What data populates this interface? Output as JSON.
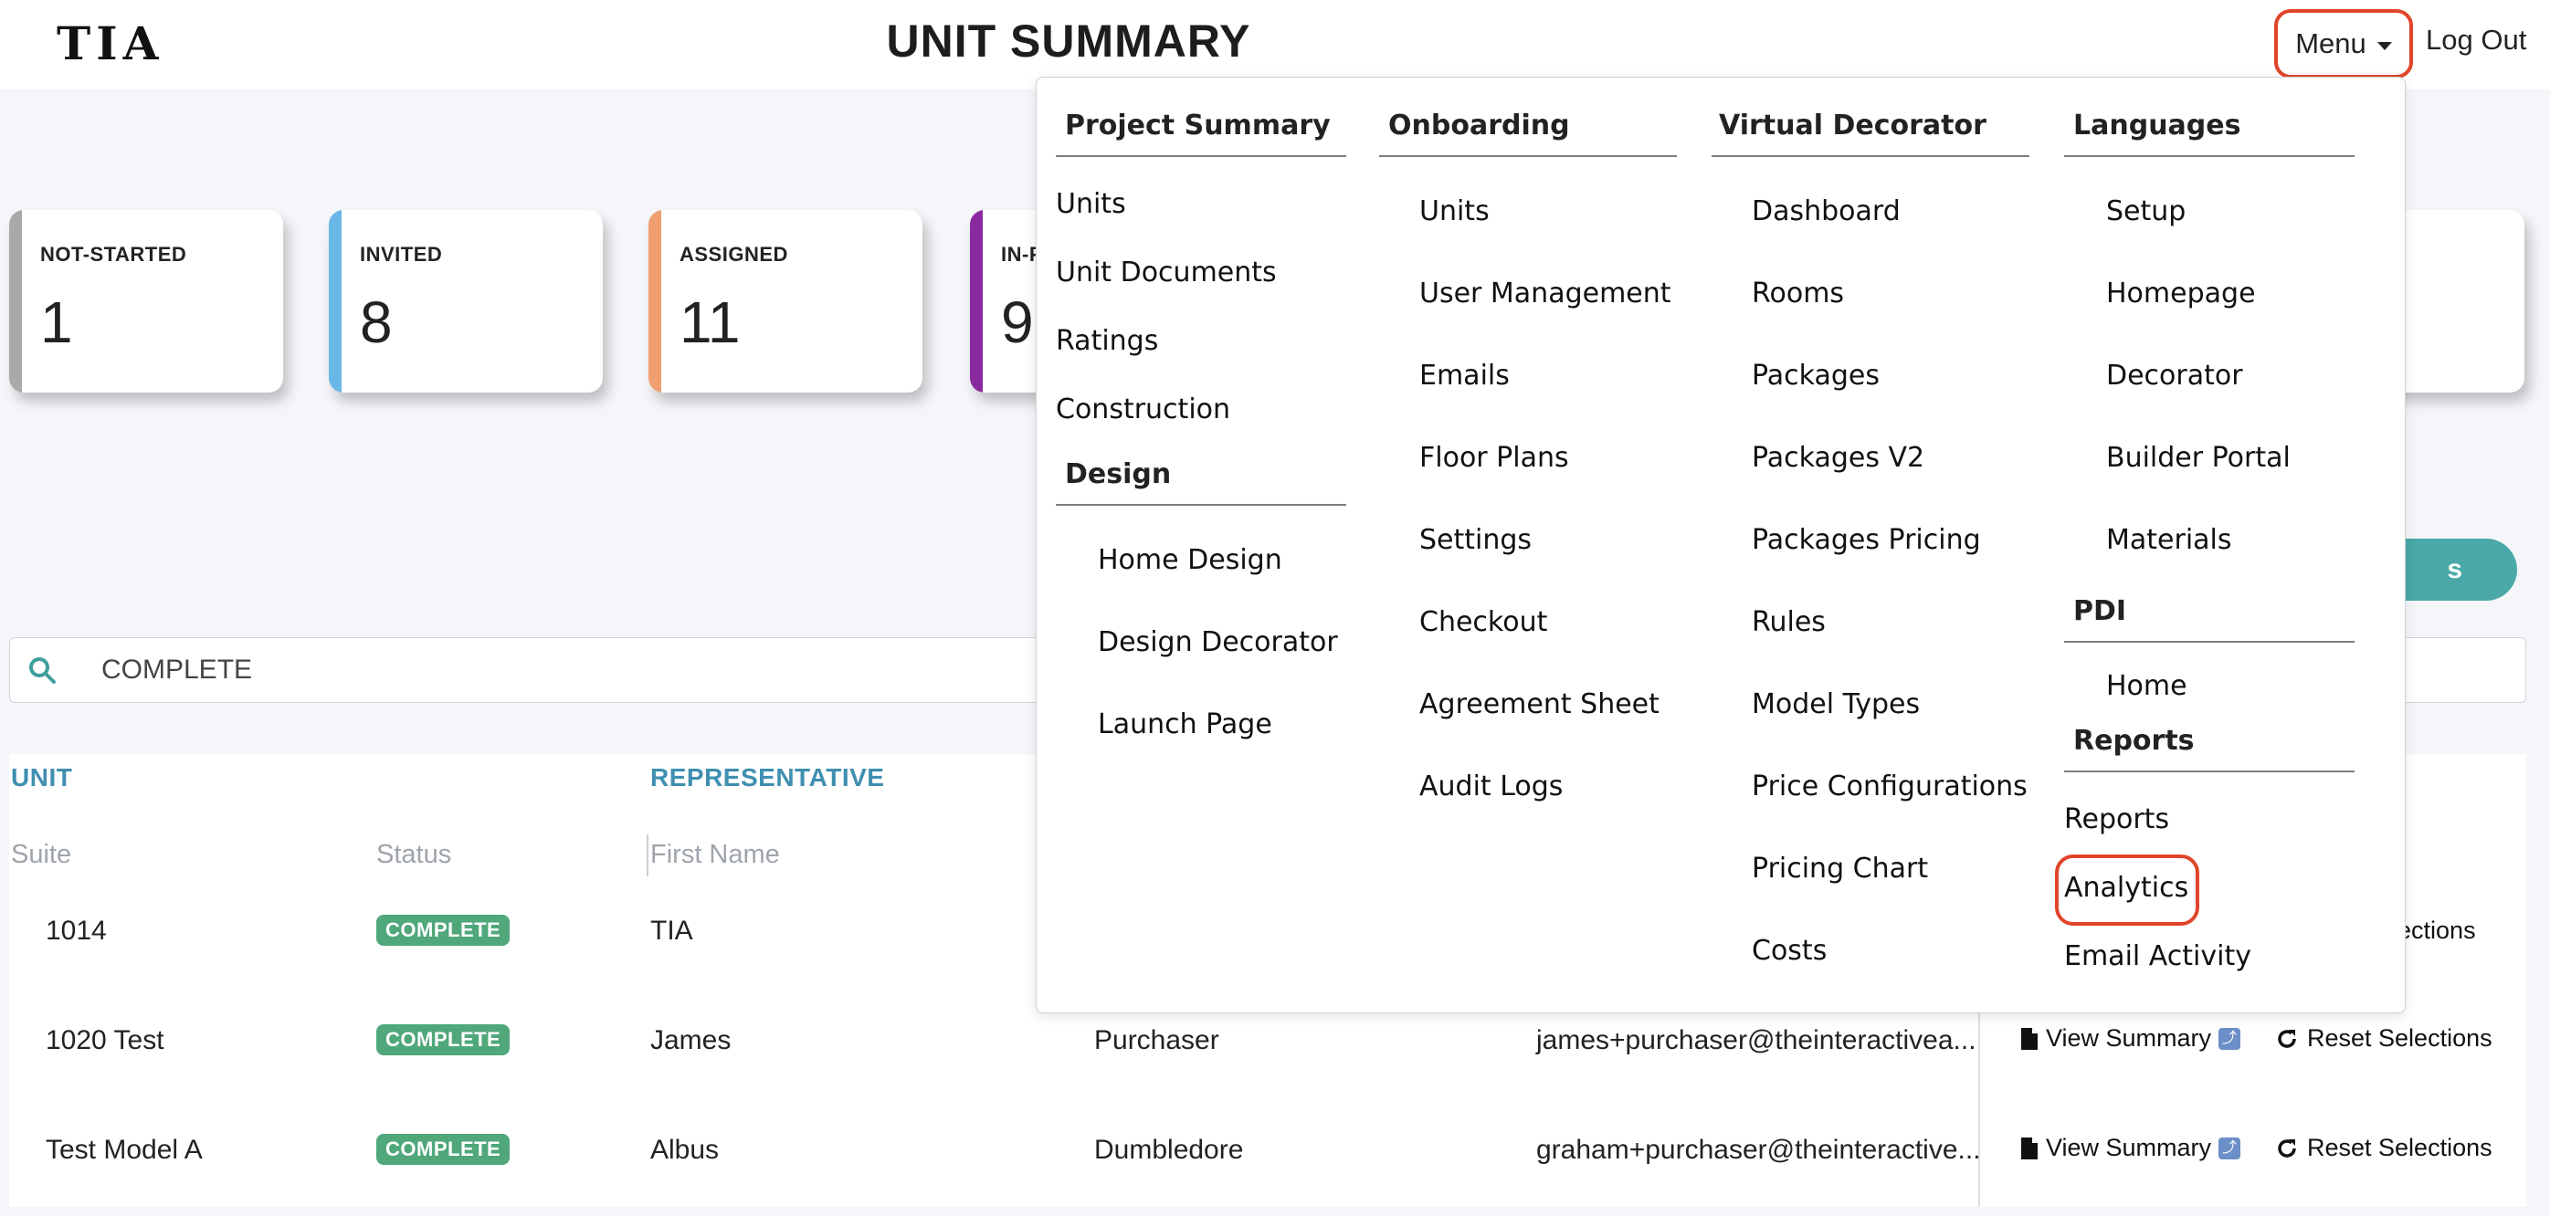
{
  "header": {
    "logo": "TIA",
    "title": "UNIT SUMMARY",
    "menu_label": "Menu",
    "logout_label": "Log Out"
  },
  "cards": [
    {
      "label": "NOT-STARTED",
      "count": "1",
      "color": "#a9a9a9"
    },
    {
      "label": "INVITED",
      "count": "8",
      "color": "#6ab8e8"
    },
    {
      "label": "ASSIGNED",
      "count": "11",
      "color": "#f0a070"
    },
    {
      "label": "IN-P",
      "count": "9",
      "color": "#8a2aa0"
    }
  ],
  "search": {
    "value": "COMPLETE"
  },
  "table": {
    "group_headers": {
      "unit": "UNIT",
      "representative": "REPRESENTATIVE"
    },
    "columns": {
      "suite": "Suite",
      "status": "Status",
      "first_name": "First Name"
    },
    "rows": [
      {
        "suite": "1014",
        "status": "COMPLETE",
        "first_name": "TIA",
        "last_name": "",
        "email": "",
        "view_summary": "",
        "reset": "elections"
      },
      {
        "suite": "1020 Test",
        "status": "COMPLETE",
        "first_name": "James",
        "last_name": "Purchaser",
        "email": "james+purchaser@theinteractivea...",
        "view_summary": "View Summary",
        "reset": "Reset Selections"
      },
      {
        "suite": "Test Model A",
        "status": "COMPLETE",
        "first_name": "Albus",
        "last_name": "Dumbledore",
        "email": "graham+purchaser@theinteractive...",
        "view_summary": "View Summary",
        "reset": "Reset Selections"
      }
    ]
  },
  "teal_button_partial": "s",
  "menu": {
    "project_summary": {
      "heading": "Project Summary",
      "items": [
        "Units",
        "Unit Documents",
        "Ratings",
        "Construction"
      ]
    },
    "design": {
      "heading": "Design",
      "items": [
        "Home Design",
        "Design Decorator",
        "Launch Page"
      ]
    },
    "onboarding": {
      "heading": "Onboarding",
      "items": [
        "Units",
        "User Management",
        "Emails",
        "Floor Plans",
        "Settings",
        "Checkout",
        "Agreement Sheet",
        "Audit Logs"
      ]
    },
    "virtual_decorator": {
      "heading": "Virtual Decorator",
      "items": [
        "Dashboard",
        "Rooms",
        "Packages",
        "Packages V2",
        "Packages Pricing",
        "Rules",
        "Model Types",
        "Price Configurations",
        "Pricing Chart",
        "Costs"
      ]
    },
    "languages": {
      "heading": "Languages",
      "items": [
        "Setup",
        "Homepage",
        "Decorator",
        "Builder Portal",
        "Materials"
      ]
    },
    "pdi": {
      "heading": "PDI",
      "items": [
        "Home"
      ]
    },
    "reports": {
      "heading": "Reports",
      "items": [
        "Reports",
        "Analytics",
        "Email Activity"
      ]
    }
  },
  "colors": {
    "accent_red": "#e0452a",
    "teal": "#4aa8a8",
    "badge_green": "#4fa77a",
    "link_blue": "#3f8fb0"
  }
}
